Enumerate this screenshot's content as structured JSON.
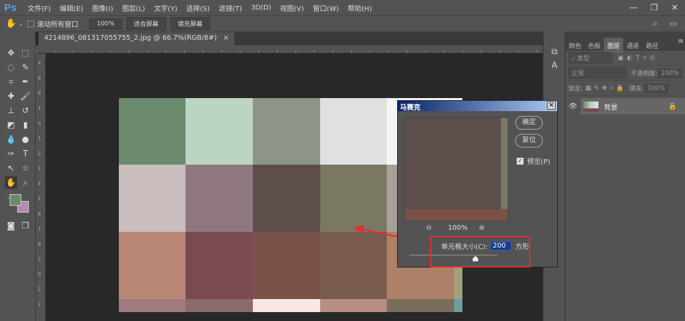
{
  "app": {
    "logo": "Ps"
  },
  "menu": [
    "文件(F)",
    "编辑(E)",
    "图像(I)",
    "图层(L)",
    "文字(Y)",
    "选择(S)",
    "滤镜(T)",
    "3D(D)",
    "视图(V)",
    "窗口(W)",
    "帮助(H)"
  ],
  "window_controls": [
    "—",
    "❐",
    "✕"
  ],
  "options": {
    "scroll_all": "滚动所有窗口",
    "zoom": "100%",
    "fit_screen": "适合屏幕",
    "fill_screen": "填充屏幕"
  },
  "document": {
    "tab_title": "4214896_081317055755_2.jpg @ 66.7%(RGB/8#)",
    "close": "×"
  },
  "ruler_left": [
    "4",
    "6",
    "8",
    "1",
    "0",
    "1",
    "2",
    "1",
    "4",
    "1",
    "6",
    "1",
    "8",
    "2",
    "0",
    "2",
    "2"
  ],
  "canvas_colors": [
    [
      "#6b8a6d",
      "#bcd4c2",
      "#8d958a",
      "#dfe1e0",
      "#f4f4f4",
      "#f4f4f4"
    ],
    [
      "#c9bdbe",
      "#8f7880",
      "#5d4d4b",
      "#7a7862",
      "#a9a09a",
      "#a9a09a"
    ],
    [
      "#bb8878",
      "#7a4a52",
      "#7a5247",
      "#795a4f",
      "#ad8068",
      "#a3a07a"
    ],
    [
      "#a07a7c",
      "#8a6b68",
      "#fbe6e3",
      "#b88e82",
      "#7a6d5c",
      "#6aa0a0"
    ]
  ],
  "panel": {
    "tabs": [
      "颜色",
      "色板",
      "图层",
      "通道",
      "路径"
    ],
    "active_tab": 2,
    "filter": "类型",
    "blend": "正常",
    "opacity_label": "不透明度:",
    "opacity": "100%",
    "lock_label": "锁定:",
    "fill_label": "填充:",
    "fill": "100%",
    "layer_name": "背景"
  },
  "mosaic_dialog": {
    "title": "马赛克",
    "ok": "确定",
    "reset": "复位",
    "preview_label": "预览(P)",
    "preview_checked": true,
    "zoom": "100%",
    "cell_size_label": "单元格大小(C):",
    "cell_size": "200",
    "unit": "方形",
    "slider_fraction": 0.75
  }
}
